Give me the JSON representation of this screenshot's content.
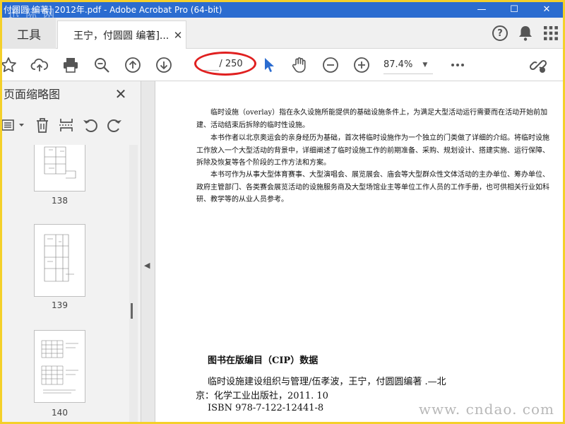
{
  "window": {
    "title": "付圆圆 编著] 2012年.pdf - Adobe Acrobat Pro (64-bit)",
    "watermark": "迅 际 网",
    "controls": {
      "minimize": "—",
      "maximize": "☐",
      "close": "✕"
    }
  },
  "tabs": {
    "tools_label": "工具",
    "doc_tab_label": "王宁，付圆圆 编著]...",
    "doc_tab_close": "✕"
  },
  "header_icons": [
    "help-icon",
    "bell-icon",
    "apps-grid-icon"
  ],
  "toolbar": {
    "page_current": "",
    "page_total": "/ 250",
    "zoom": "87.4%",
    "icons": [
      "star-icon",
      "cloud-upload-icon",
      "print-icon",
      "zoom-out-search-icon",
      "page-up-icon",
      "page-down-icon",
      "select-cursor-icon",
      "hand-tool-icon",
      "zoom-minus-icon",
      "zoom-plus-icon",
      "more-icon",
      "share-link-icon"
    ]
  },
  "sidepanel": {
    "title": "页面缩略图",
    "close": "✕",
    "thumbnails": [
      {
        "page": "138"
      },
      {
        "page": "139"
      },
      {
        "page": "140"
      }
    ]
  },
  "document": {
    "paragraphs": [
      "临时设施（overlay）指在永久设施所能提供的基础设施条件上，为满足大型活动运行需要而在活动开始前加建、活动结束后拆除的临时性设施。",
      "本书作者以北京奥运会的亲身经历为基础，首次将临时设施作为一个独立的门类做了详细的介绍。将临时设施工作放入一个大型活动的背景中，详细阐述了临时设施工作的前期准备、采购、规划设计、搭建实施、运行保障、拆除及恢复等各个阶段的工作方法和方案。",
      "本书可作为从事大型体育赛事、大型演唱会、展览展会、庙会等大型群众性文体活动的主办单位、筹办单位、政府主管部门、各类赛会展览活动的设施服务商及大型场馆业主等单位工作人员的工作手册，也可供相关行业如科研、教学等的从业人员参考。"
    ],
    "cip_title": "图书在版编目（CIP）数据",
    "cip_line1": "临时设施建设组织与管理/伍孝波，王宁，付圆圆编著 .—北",
    "cip_line2": "京：化学工业出版社，2011. 10",
    "cip_line3": "ISBN 978-7-122-12441-8"
  },
  "watermark_br": "www. cndao. com",
  "colors": {
    "titlebar": "#2b6cd0",
    "frame": "#f4d02a",
    "annotation": "#e02020",
    "cursor": "#2b6cd0"
  }
}
